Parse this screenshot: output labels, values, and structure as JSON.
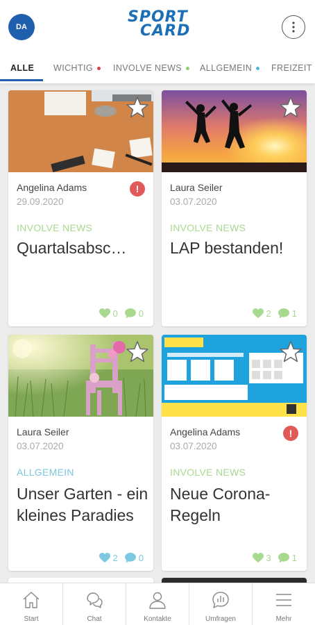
{
  "header": {
    "avatar_initials": "DA",
    "logo_line1": "SPORT",
    "logo_line2": "CARD"
  },
  "tabs": [
    {
      "label": "ALLE",
      "active": true,
      "dot": null
    },
    {
      "label": "WICHTIG",
      "active": false,
      "dot": "#d9414a"
    },
    {
      "label": "INVOLVE NEWS",
      "active": false,
      "dot": "#8fcf6f"
    },
    {
      "label": "ALLGEMEIN",
      "active": false,
      "dot": "#4fb8d8"
    },
    {
      "label": "FREIZEIT",
      "active": false,
      "dot": null
    }
  ],
  "colors": {
    "brand": "#1f5fae",
    "involve_news": "#a9d88f",
    "allgemein": "#7cc8e0",
    "important": "#e05a5a"
  },
  "cards": [
    {
      "author": "Angelina Adams",
      "date": "29.09.2020",
      "important": true,
      "alert_symbol": "!",
      "category": "INVOLVE NEWS",
      "title": "Quartalsabsc…",
      "likes": "0",
      "comments": "0"
    },
    {
      "author": "Laura Seiler",
      "date": "03.07.2020",
      "important": false,
      "category": "INVOLVE NEWS",
      "title": "LAP bestanden!",
      "likes": "2",
      "comments": "1"
    },
    {
      "author": "Laura Seiler",
      "date": "03.07.2020",
      "important": false,
      "category": "ALLGEMEIN",
      "title": "Unser Garten - ein kleines Paradies",
      "likes": "2",
      "comments": "0"
    },
    {
      "author": "Angelina Adams",
      "date": "03.07.2020",
      "important": true,
      "alert_symbol": "!",
      "category": "INVOLVE NEWS",
      "title": "Neue Corona-Regeln",
      "likes": "3",
      "comments": "1"
    }
  ],
  "nav": [
    {
      "label": "Start",
      "icon": "home-icon"
    },
    {
      "label": "Chat",
      "icon": "chat-icon"
    },
    {
      "label": "Kontakte",
      "icon": "person-icon"
    },
    {
      "label": "Umfragen",
      "icon": "poll-icon"
    },
    {
      "label": "Mehr",
      "icon": "hamburger-icon"
    }
  ]
}
